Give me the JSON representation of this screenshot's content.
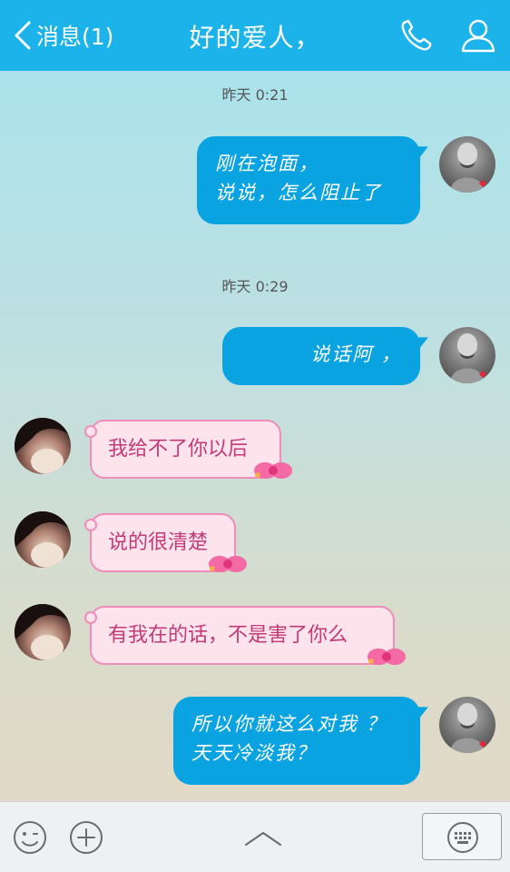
{
  "header": {
    "back_label": "消息(1)",
    "title": "好的爱人，",
    "accent_color": "#1cb3ea",
    "icons": [
      "chevron-left-icon",
      "phone-icon",
      "user-profile-icon"
    ]
  },
  "messages": [
    {
      "type": "time",
      "text": "昨天 0:21"
    },
    {
      "type": "sent",
      "lines": [
        "刚在泡面，",
        "说说，怎么阻止了"
      ]
    },
    {
      "type": "time",
      "text": "昨天 0:29"
    },
    {
      "type": "sent",
      "lines": [
        "说话阿 ，"
      ]
    },
    {
      "type": "received",
      "text": "我给不了你以后"
    },
    {
      "type": "received",
      "text": "说的很清楚"
    },
    {
      "type": "received",
      "text": "有我在的话，不是害了你么"
    },
    {
      "type": "sent",
      "lines": [
        "所以你就这么对我 ？",
        "天天冷淡我？"
      ]
    }
  ],
  "bottom_bar": {
    "icons": [
      "emoji-icon",
      "plus-icon",
      "chevron-up-icon",
      "keyboard-icon"
    ]
  },
  "colors": {
    "sent_bubble": "#0aa3e2",
    "received_bubble": "#fde3ec",
    "received_border": "#f08dbb",
    "received_text": "#c23b76"
  }
}
